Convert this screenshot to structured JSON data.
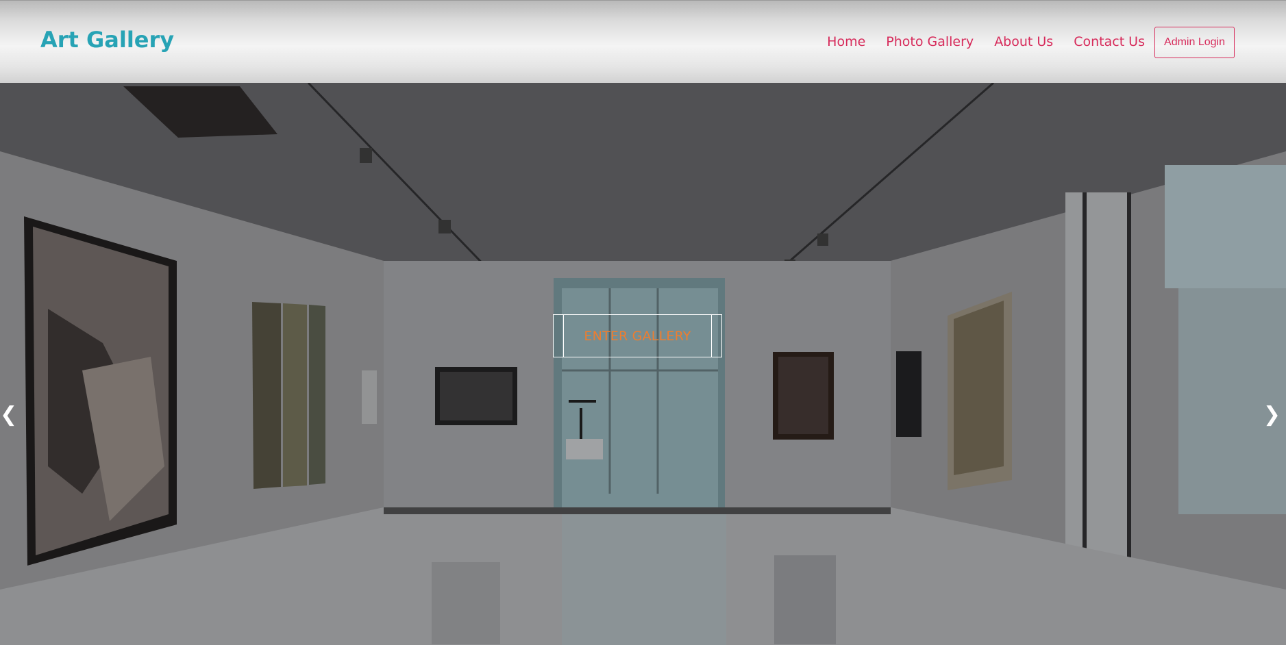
{
  "header": {
    "brand": "Art Gallery",
    "nav": [
      {
        "label": "Home"
      },
      {
        "label": "Photo Gallery"
      },
      {
        "label": "About Us"
      },
      {
        "label": "Contact Us"
      }
    ],
    "admin_label": "Admin Login"
  },
  "hero": {
    "cta_label": "ENTER GALLERY",
    "prev_arrow": "❮",
    "next_arrow": "❯"
  },
  "colors": {
    "brand": "#27a3b5",
    "nav": "#d72b5b",
    "cta": "#ef7d2e"
  }
}
